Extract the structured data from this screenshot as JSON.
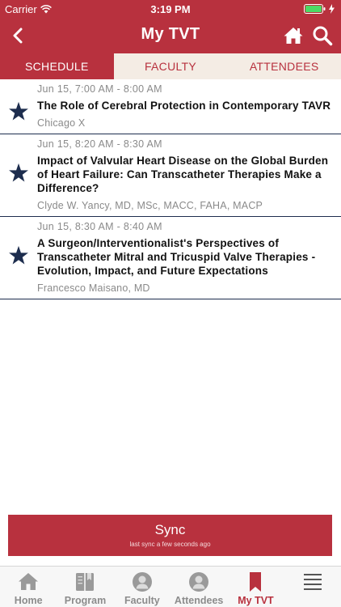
{
  "status_bar": {
    "carrier": "Carrier",
    "time": "3:19 PM"
  },
  "nav": {
    "title": "My TVT"
  },
  "tabs": [
    {
      "label": "SCHEDULE",
      "active": true
    },
    {
      "label": "FACULTY",
      "active": false
    },
    {
      "label": "ATTENDEES",
      "active": false
    }
  ],
  "sessions": [
    {
      "time": "Jun 15, 7:00 AM - 8:00 AM",
      "title": "The Role of Cerebral Protection in Contemporary TAVR",
      "speaker": "Chicago X"
    },
    {
      "time": "Jun 15, 8:20 AM - 8:30 AM",
      "title": "Impact of Valvular Heart Disease on the Global Burden of Heart Failure:  Can Transcatheter Therapies Make a Difference?",
      "speaker": "Clyde W. Yancy, MD, MSc, MACC, FAHA, MACP"
    },
    {
      "time": "Jun 15, 8:30 AM - 8:40 AM",
      "title": "A Surgeon/Interventionalist's Perspectives of Transcatheter Mitral and Tricuspid Valve Therapies - Evolution, Impact, and Future Expectations",
      "speaker": "Francesco Maisano, MD"
    }
  ],
  "sync": {
    "label": "Sync",
    "subtext": "last sync a few seconds ago"
  },
  "tabbar": [
    {
      "label": "Home",
      "icon": "home-icon",
      "active": false
    },
    {
      "label": "Program",
      "icon": "book-icon",
      "active": false
    },
    {
      "label": "Faculty",
      "icon": "person-icon",
      "active": false
    },
    {
      "label": "Attendees",
      "icon": "person-icon",
      "active": false
    },
    {
      "label": "My TVT",
      "icon": "bookmark-icon",
      "active": true
    },
    {
      "label": "",
      "icon": "menu-icon",
      "active": false
    }
  ],
  "colors": {
    "brand": "#b8313e",
    "star": "#1d2d4e",
    "tab_bg": "#f4ece4"
  }
}
